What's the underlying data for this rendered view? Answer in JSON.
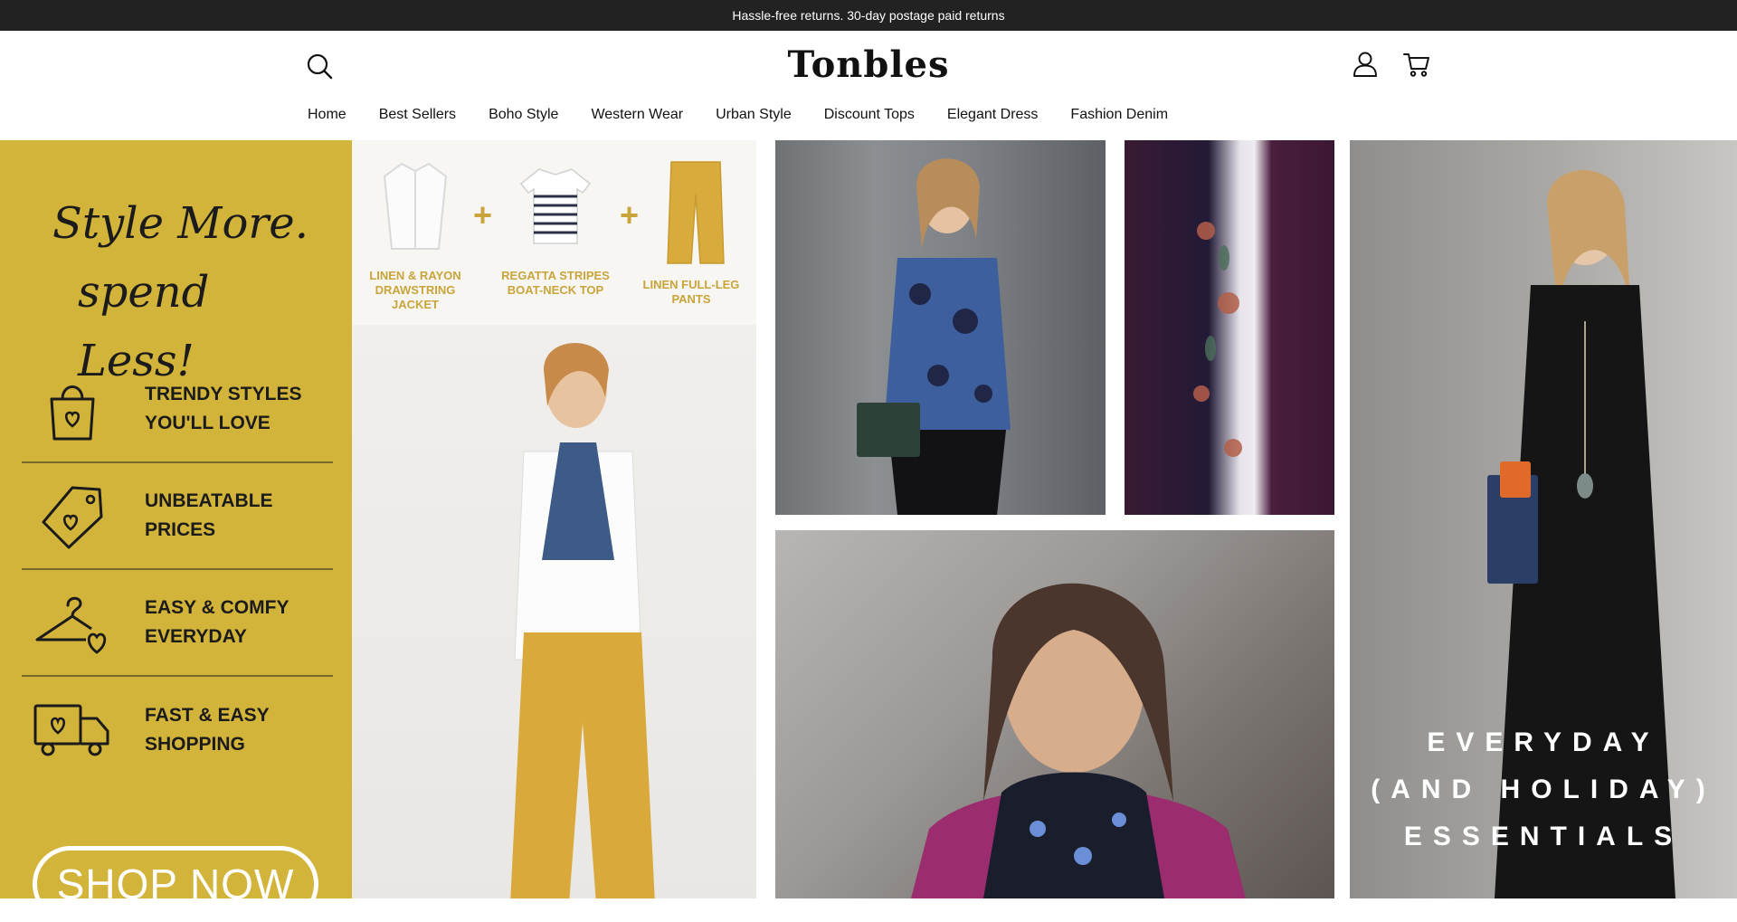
{
  "announcement": "Hassle-free returns. 30-day postage paid returns",
  "brand": "Tonbles",
  "nav": [
    "Home",
    "Best Sellers",
    "Boho Style",
    "Western Wear",
    "Urban Style",
    "Discount Tops",
    "Elegant Dress",
    "Fashion Denim"
  ],
  "promo": {
    "headline_1": "Style More.",
    "headline_2": "spend Less!",
    "features": [
      {
        "label": "Trendy styles you'll love",
        "icon": "shopping-bag-heart-icon"
      },
      {
        "label": "Unbeatable prices",
        "icon": "price-tag-heart-icon"
      },
      {
        "label": "Easy & comfy everyday",
        "icon": "hanger-heart-icon"
      },
      {
        "label": "Fast & easy shopping",
        "icon": "delivery-truck-heart-icon"
      }
    ],
    "cta": "SHOP NOW"
  },
  "flatlay": {
    "items": [
      "LINEN & RAYON DRAWSTRING JACKET",
      "REGATTA STRIPES BOAT-NECK TOP",
      "LINEN FULL-LEG PANTS"
    ],
    "plus": "+"
  },
  "banner": {
    "line1": "EVERYDAY",
    "line2": "(AND HOLIDAY)",
    "line3": "ESSENTIALS"
  },
  "colors": {
    "promo_bg": "#d3b43a",
    "announcement_bg": "#222222",
    "accent_mustard": "#c9a43a"
  }
}
